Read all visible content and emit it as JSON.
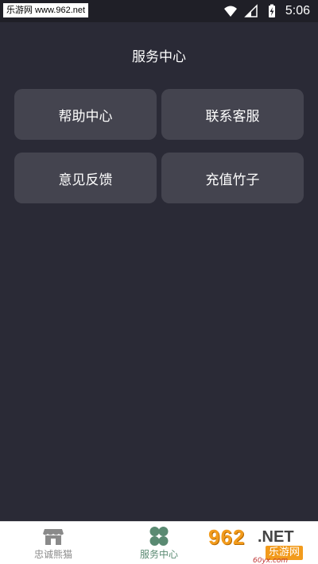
{
  "status_bar": {
    "watermark": "乐游网 www.962.net",
    "time": "5:06"
  },
  "header": {
    "title": "服务中心"
  },
  "tiles": [
    {
      "label": "帮助中心"
    },
    {
      "label": "联系客服"
    },
    {
      "label": "意见反馈"
    },
    {
      "label": "充值竹子"
    }
  ],
  "bottom_nav": {
    "items": [
      {
        "label": "忠诚熊猫",
        "icon": "store-icon",
        "active": false
      },
      {
        "label": "服务中心",
        "icon": "clover-icon",
        "active": true
      }
    ]
  },
  "watermark_br": {
    "logo_number": "962",
    "logo_suffix": ".NET",
    "logo_cn": "乐游网",
    "small_text": "60yx.com"
  },
  "colors": {
    "background": "#2a2a36",
    "tile": "#44444f",
    "active_nav": "#5a8a72",
    "inactive_nav": "#8a8a8a",
    "watermark_orange": "#f29b1c"
  }
}
